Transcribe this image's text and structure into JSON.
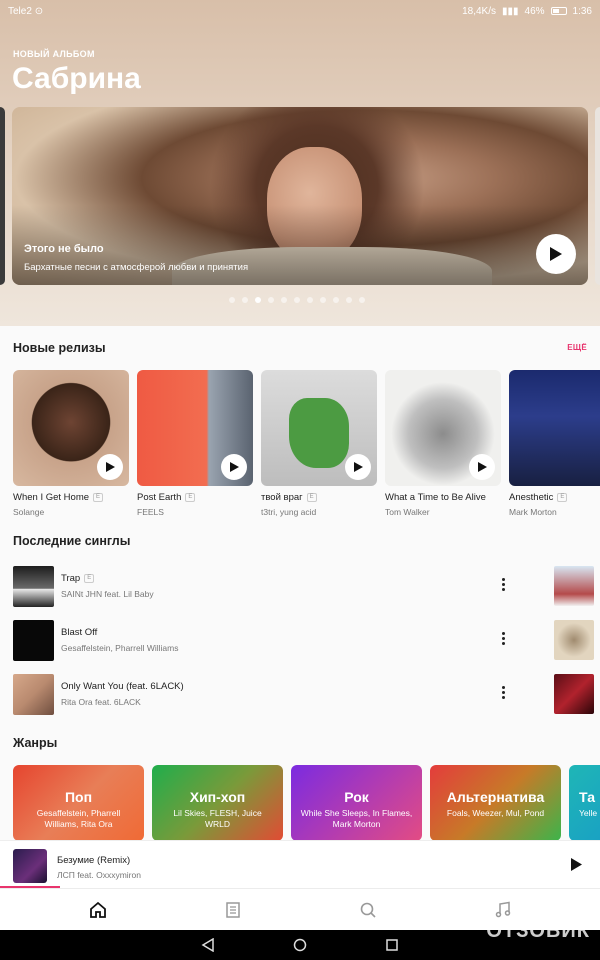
{
  "status_bar": {
    "carrier": "Tele2",
    "net_speed": "18,4K/s",
    "battery": "46%",
    "time": "1:36"
  },
  "hero": {
    "eyebrow": "НОВЫЙ АЛЬБОМ",
    "title": "Сабрина",
    "banner": {
      "title": "Этого не было",
      "subtitle": "Бархатные песни с атмосферой любви и принятия"
    },
    "carousel": {
      "count": 11,
      "active_index": 2
    }
  },
  "new_releases": {
    "heading": "Новые релизы",
    "more_label": "ЕЩЁ",
    "explicit_label": "E",
    "items": [
      {
        "title": "When I Get Home",
        "artist": "Solange",
        "explicit": true
      },
      {
        "title": "Post Earth",
        "artist": "FEELS",
        "explicit": true
      },
      {
        "title": "твой враг",
        "artist": "t3tri, yung acid",
        "explicit": true
      },
      {
        "title": "What a Time to Be Alive",
        "artist": "Tom Walker",
        "explicit": false
      },
      {
        "title": "Anesthetic",
        "artist": "Mark Morton",
        "explicit": true
      }
    ]
  },
  "singles": {
    "heading": "Последние синглы",
    "items": [
      {
        "title": "Trap",
        "artist": "SAINt JHN feat. Lil Baby",
        "explicit": true
      },
      {
        "title": "Blast Off",
        "artist": "Gesaffelstein, Pharrell Williams",
        "explicit": false
      },
      {
        "title": "Only Want You (feat. 6LACK)",
        "artist": "Rita Ora feat. 6LACK",
        "explicit": false
      }
    ]
  },
  "genres": {
    "heading": "Жанры",
    "items": [
      {
        "name": "Поп",
        "artists": "Gesaffelstein, Pharrell Williams, Rita Ora"
      },
      {
        "name": "Хип-хоп",
        "artists": "Lil Skies, FLESH, Juice WRLD"
      },
      {
        "name": "Рок",
        "artists": "While She Sleeps, In Flames, Mark Morton"
      },
      {
        "name": "Альтернатива",
        "artists": "Foals, Weezer, Mul, Pond"
      },
      {
        "name": "Та",
        "artists": "Yelle"
      }
    ]
  },
  "now_playing": {
    "title": "Безумие (Remix)",
    "artist": "ЛСП feat. Oxxxymiron",
    "progress": 0.1
  },
  "bottom_nav": {
    "items": [
      "home",
      "library",
      "search",
      "music"
    ],
    "active": "home"
  },
  "watermark": "ОТЗОВИК",
  "colors": {
    "accent": "#e8346d"
  }
}
